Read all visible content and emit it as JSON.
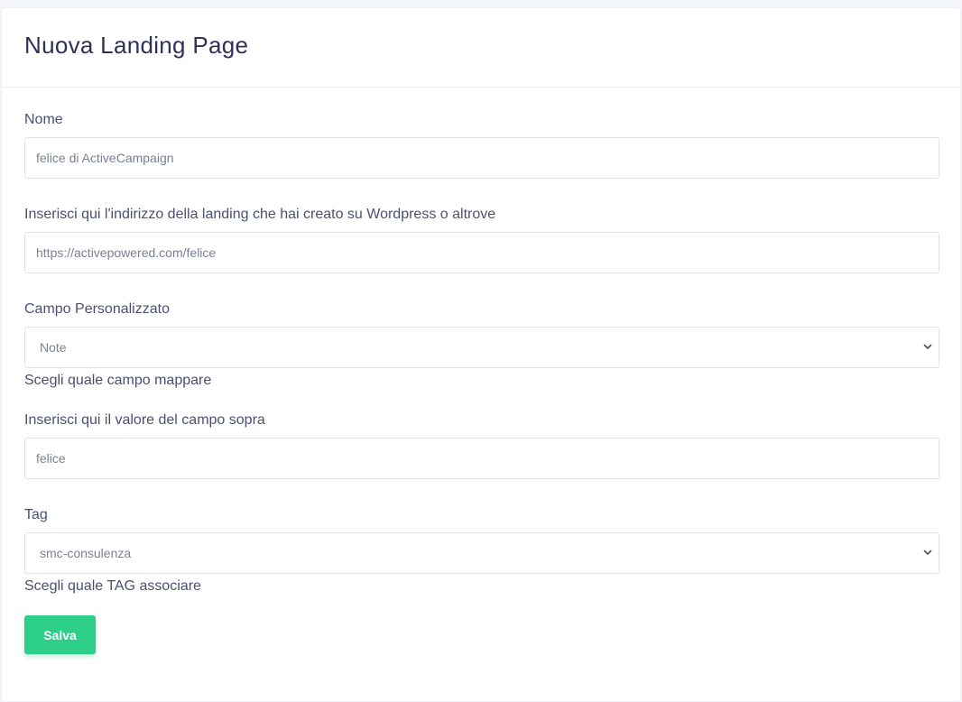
{
  "header": {
    "title": "Nuova Landing Page"
  },
  "form": {
    "name": {
      "label": "Nome",
      "value": "felice di ActiveCampaign"
    },
    "url": {
      "label": "Inserisci qui l'indirizzo della landing che hai creato su Wordpress o altrove",
      "value": "https://activepowered.com/felice"
    },
    "custom_field": {
      "label": "Campo Personalizzato",
      "selected": "Note",
      "help": "Scegli quale campo mappare"
    },
    "field_value": {
      "label": "Inserisci qui il valore del campo sopra",
      "value": "felice"
    },
    "tag": {
      "label": "Tag",
      "selected": "smc-consulenza",
      "help": "Scegli quale TAG associare"
    },
    "save_label": "Salva"
  },
  "colors": {
    "accent": "#2dce89",
    "title": "#2f3257",
    "text": "#4a5072"
  }
}
